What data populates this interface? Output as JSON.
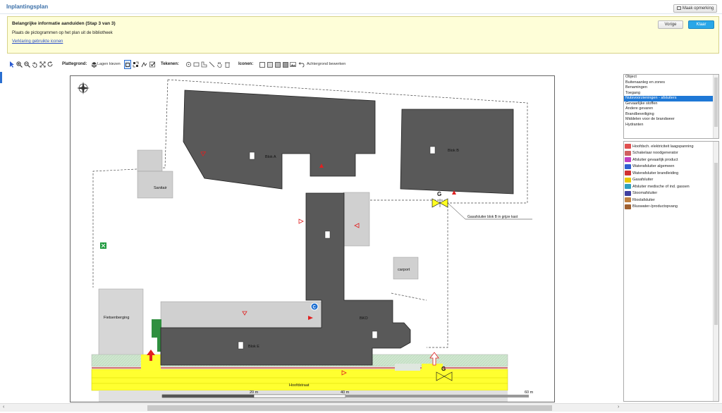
{
  "header": {
    "title": "Inplantingsplan",
    "remark_button": "Maak opmerking"
  },
  "info": {
    "title": "Belangrijke informatie aanduiden (Stap 3 van 3)",
    "text": "Plaats de pictogrammen op het plan uit de bibliotheek",
    "link": "Verklaring gebruikte iconen",
    "prev_button": "Vorige",
    "done_button": "Klaar"
  },
  "toolbar": {
    "plattegrond_label": "Plattegrond:",
    "layers_button": "Lagen kiezen",
    "tekenen_label": "Tekenen:",
    "iconen_label": "Iconen:",
    "background_button": "Achtergrond bewerken"
  },
  "plan": {
    "blok_a": "Blok A",
    "blok_b": "Blok B",
    "blok_e": "Blok E",
    "bko": "BKO",
    "sanitair": "Sanitair",
    "carport": "carport",
    "fietsenberging": "Fietsenberging",
    "hoofdstraat": "Hoofdstraat",
    "gas_annotation": "Gasafsluiter blok B in grijze kast",
    "g_label": "G",
    "c_label": "C",
    "scale_20": "20 m",
    "scale_40": "40 m",
    "scale_60": "60 m"
  },
  "layers": [
    "Object",
    "Buitenaanleg en zones",
    "Benamingen",
    "Toegang",
    "Nutsvoorzieningen - afsluiters",
    "Gevaarlijke stoffen",
    "Andere gevaren",
    "Brandbeveiliging",
    "Middelen voor de brandweer",
    "Hydranten"
  ],
  "selected_layer_index": 4,
  "icons": [
    {
      "label": "Hoofdsch. elektriciteit laagspanning",
      "color": "#e05050"
    },
    {
      "label": "Schakelaar noodgenerator",
      "color": "#d06060"
    },
    {
      "label": "Afsluiter gevaarlijk product",
      "color": "#c040c0"
    },
    {
      "label": "Waterafsluiter algemeen",
      "color": "#3060d0"
    },
    {
      "label": "Waterafsluiter brandleiding",
      "color": "#d03030"
    },
    {
      "label": "Gasafsluiter",
      "color": "#e8c800"
    },
    {
      "label": "Afsluiter medische of ind. gassen",
      "color": "#30a0c0"
    },
    {
      "label": "Stoomafsluiter",
      "color": "#4040a0"
    },
    {
      "label": "Rioolafsluiter",
      "color": "#c08040"
    },
    {
      "label": "Bluswater-/productopvang",
      "color": "#a06030"
    }
  ]
}
